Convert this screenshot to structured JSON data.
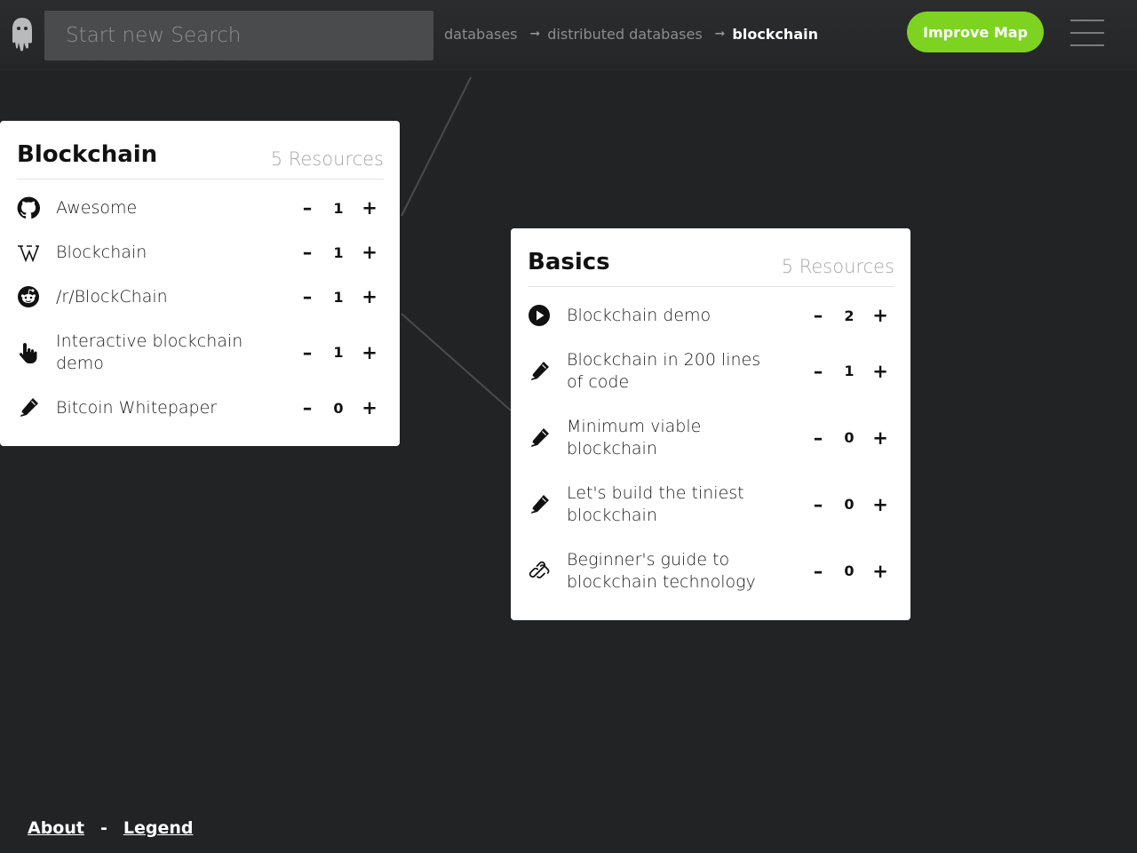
{
  "header": {
    "search_placeholder": "Start new Search",
    "breadcrumb": [
      "databases",
      "distributed databases",
      "blockchain"
    ],
    "arrow": "➞",
    "improve_label": "Improve Map"
  },
  "colors": {
    "background": "#222325",
    "accent": "#7ed321",
    "card": "#ffffff"
  },
  "cards": [
    {
      "title": "Blockchain",
      "count": "5 Resources",
      "resources": [
        {
          "icon": "github-icon",
          "label": "Awesome",
          "votes": "1"
        },
        {
          "icon": "wikipedia-icon",
          "label": "Blockchain",
          "votes": "1"
        },
        {
          "icon": "reddit-icon",
          "label": "/r/BlockChain",
          "votes": "1"
        },
        {
          "icon": "hand-pointer-icon",
          "label": "Interactive blockchain demo",
          "votes": "1"
        },
        {
          "icon": "pencil-icon",
          "label": "Bitcoin Whitepaper",
          "votes": "0"
        }
      ]
    },
    {
      "title": "Basics",
      "count": "5 Resources",
      "resources": [
        {
          "icon": "play-icon",
          "label": "Blockchain demo",
          "votes": "2"
        },
        {
          "icon": "pencil-icon",
          "label": "Blockchain in 200 lines of code",
          "votes": "1"
        },
        {
          "icon": "pencil-icon",
          "label": "Minimum viable blockchain",
          "votes": "0"
        },
        {
          "icon": "pencil-icon",
          "label": "Let's build the tiniest blockchain",
          "votes": "0"
        },
        {
          "icon": "link-icon",
          "label": "Beginner's guide to blockchain technology",
          "votes": "0"
        }
      ]
    }
  ],
  "vote": {
    "down": "–",
    "up": "+"
  },
  "footer": {
    "about": "About",
    "separator": "-",
    "legend": "Legend"
  }
}
